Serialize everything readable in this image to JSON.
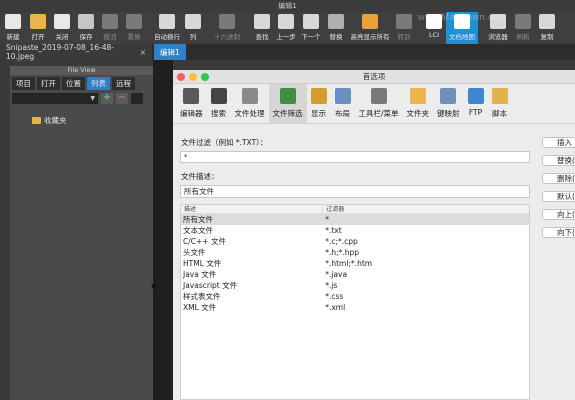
{
  "window": {
    "title": "编辑1"
  },
  "toolbar": {
    "buttons": [
      {
        "label": "新建",
        "icon": "new-file-icon",
        "color": "#e8e8e8"
      },
      {
        "label": "打开",
        "icon": "folder-open-icon",
        "color": "#e9b44c"
      },
      {
        "label": "关闭",
        "icon": "close-file-icon",
        "color": "#e8e8e8"
      },
      {
        "label": "保存",
        "icon": "save-icon",
        "color": "#c7c7c7"
      },
      {
        "label": "撤消",
        "icon": "undo-icon",
        "color": "#7a7a7a"
      },
      {
        "label": "重做",
        "icon": "redo-icon",
        "color": "#7a7a7a"
      },
      {
        "label": "自动换行",
        "icon": "word-wrap-icon",
        "color": "#d8d8d8"
      },
      {
        "label": "列",
        "icon": "column-mode-icon",
        "color": "#d8d8d8"
      },
      {
        "label": "十六进制",
        "icon": "hex-icon",
        "color": "#7a7a7a"
      },
      {
        "label": "查找",
        "icon": "find-icon",
        "color": "#d8d8d8"
      },
      {
        "label": "上一步",
        "icon": "find-prev-icon",
        "color": "#d8d8d8"
      },
      {
        "label": "下一个",
        "icon": "find-next-icon",
        "color": "#d8d8d8"
      },
      {
        "label": "替换",
        "icon": "replace-icon",
        "color": "#b0b0b0"
      },
      {
        "label": "高亮显示所有",
        "icon": "highlight-all-icon",
        "color": "#e9a23b"
      },
      {
        "label": "转到",
        "icon": "goto-icon",
        "color": "#7a7a7a"
      },
      {
        "label": "LCI",
        "icon": "lci-icon",
        "color": "#ffffff"
      },
      {
        "label": "文档地图",
        "icon": "document-map-icon",
        "color": "#ffffff"
      },
      {
        "label": "浏览器",
        "icon": "browser-icon",
        "color": "#d8d8d8"
      },
      {
        "label": "刷新",
        "icon": "refresh-icon",
        "color": "#7a7a7a"
      },
      {
        "label": "复制",
        "icon": "copy-icon",
        "color": "#d8d8d8"
      }
    ]
  },
  "watermark": "www.MacDown.com",
  "tabs": {
    "file": "Snipaste_2019-07-08_16-48-10.jpeg",
    "edit": "编辑1",
    "close": "×"
  },
  "fileview": {
    "title": "File View",
    "tabs": [
      "项目",
      "打开",
      "位置",
      "列表",
      "远程"
    ],
    "selected_tab": "列表",
    "add": "+",
    "remove": "−",
    "item": "收藏夹"
  },
  "dialog": {
    "title": "首选项",
    "icons": [
      {
        "label": "编辑器",
        "icon": "editor-tools-icon",
        "color": "#5a5a5a"
      },
      {
        "label": "搜索",
        "icon": "binoculars-icon",
        "color": "#444444"
      },
      {
        "label": "文件处理",
        "icon": "file-handling-icon",
        "color": "#8a8a8a"
      },
      {
        "label": "文件筛选",
        "icon": "file-filter-icon",
        "color": "#3f8f3f"
      },
      {
        "label": "显示",
        "icon": "display-pen-icon",
        "color": "#d59b2e"
      },
      {
        "label": "布局",
        "icon": "layout-icon",
        "color": "#6b8fc0"
      },
      {
        "label": "工具栏/菜单",
        "icon": "toolbar-menu-icon",
        "color": "#7a7a7a"
      },
      {
        "label": "文件夹",
        "icon": "folder-icon",
        "color": "#e9b44c"
      },
      {
        "label": "键映射",
        "icon": "keymap-icon",
        "color": "#6f8fb8"
      },
      {
        "label": "FTP",
        "icon": "ftp-icon",
        "color": "#3d88d0"
      },
      {
        "label": "脚本",
        "icon": "script-icon",
        "color": "#e0b44a"
      }
    ],
    "selected_icon": "文件筛选",
    "filter_label": "文件过滤（例如 *.TXT）：",
    "filter_value": "*",
    "desc_label": "文件描述：",
    "desc_value": "所有文件",
    "table": {
      "headers": [
        "描述",
        "过滤器"
      ],
      "rows": [
        [
          "所有文件",
          "*"
        ],
        [
          "文本文件",
          "*.txt"
        ],
        [
          "C/C++ 文件",
          "*.c;*.cpp"
        ],
        [
          "头文件",
          "*.h;*.hpp"
        ],
        [
          "HTML 文件",
          "*.html;*.htm"
        ],
        [
          "Java 文件",
          "*.java"
        ],
        [
          "Javascript 文件",
          "*.js"
        ],
        [
          "样式表文件",
          "*.css"
        ],
        [
          "XML 文件",
          "*.xml"
        ]
      ]
    },
    "buttons": [
      "插入",
      "替换(R)",
      "删除(D)",
      "默认(F)",
      "向上(U)",
      "向下(W)"
    ]
  },
  "colors": {
    "accent": "#2f80c8",
    "traffic_red": "#fc605c",
    "traffic_yellow": "#fdbc40",
    "traffic_green": "#34c84a"
  }
}
